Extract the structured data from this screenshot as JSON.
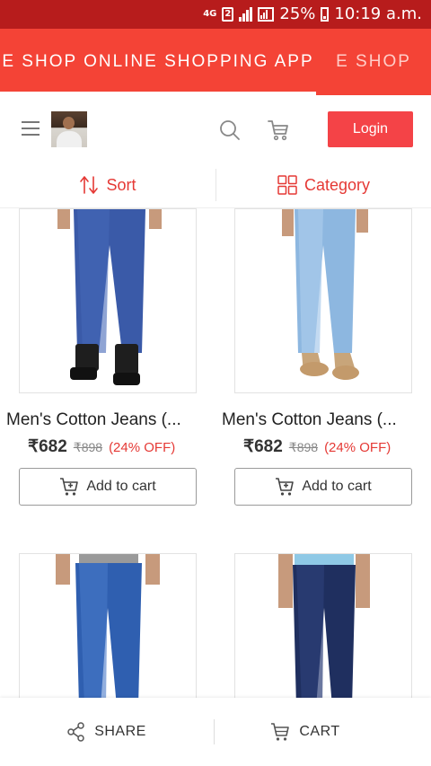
{
  "status_bar": {
    "network": "4G",
    "sim": "2",
    "battery": "25%",
    "time": "10:19 a.m."
  },
  "tabs": [
    {
      "label": "E SHOP ONLINE SHOPPING APP",
      "active": true
    },
    {
      "label": "E SHOP",
      "active": false
    }
  ],
  "toolbar": {
    "menu_icon": "hamburger-icon",
    "search_icon": "search-icon",
    "cart_icon": "cart-icon",
    "login_label": "Login"
  },
  "sort_bar": {
    "sort_label": "Sort",
    "category_label": "Category"
  },
  "products": [
    {
      "name": "Men's Cotton Jeans (...",
      "price": "₹682",
      "mrp": "₹898",
      "discount": "(24% OFF)",
      "add_to_cart": "Add to cart"
    },
    {
      "name": "Men's Cotton Jeans (...",
      "price": "₹682",
      "mrp": "₹898",
      "discount": "(24% OFF)",
      "add_to_cart": "Add to cart"
    }
  ],
  "bottom_bar": {
    "share_label": "SHARE",
    "cart_label": "CART"
  },
  "colors": {
    "status_bar": "#b71c1c",
    "app_bar": "#f44336",
    "accent": "#e53935",
    "login_button": "#f44347"
  }
}
